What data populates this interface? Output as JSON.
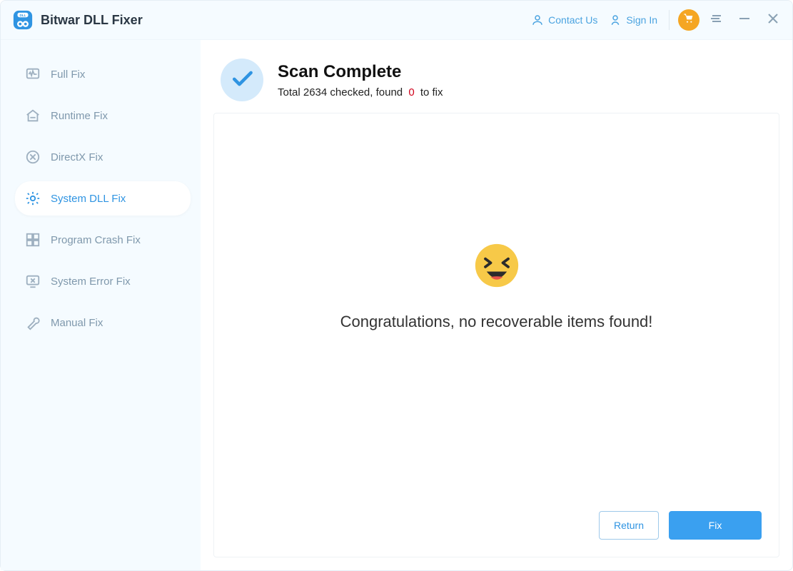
{
  "header": {
    "title": "Bitwar DLL Fixer",
    "contact": "Contact Us",
    "signin": "Sign In"
  },
  "sidebar": {
    "items": [
      {
        "label": "Full Fix"
      },
      {
        "label": "Runtime Fix"
      },
      {
        "label": "DirectX Fix"
      },
      {
        "label": "System DLL Fix"
      },
      {
        "label": "Program Crash Fix"
      },
      {
        "label": "System Error Fix"
      },
      {
        "label": "Manual Fix"
      }
    ],
    "active_index": 3
  },
  "result": {
    "title": "Scan Complete",
    "sub_prefix": "Total 2634 checked, found",
    "found_count": "0",
    "sub_suffix": "to fix",
    "congrats": "Congratulations, no recoverable items found!"
  },
  "buttons": {
    "return": "Return",
    "fix": "Fix"
  }
}
